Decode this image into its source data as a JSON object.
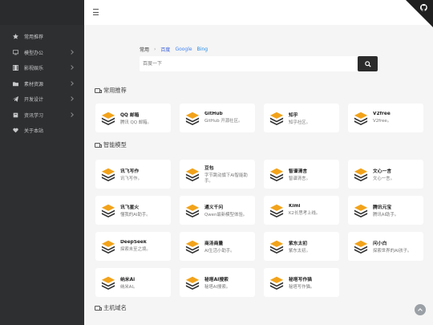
{
  "sidebar": {
    "items": [
      {
        "label": "常用推荐",
        "icon": "star-icon",
        "arrow": false
      },
      {
        "label": "模型办公",
        "icon": "monitor-icon",
        "arrow": true
      },
      {
        "label": "影视娱乐",
        "icon": "film-icon",
        "arrow": true
      },
      {
        "label": "素材资源",
        "icon": "folder-icon",
        "arrow": true
      },
      {
        "label": "开发设计",
        "icon": "paper-plane-icon",
        "arrow": true
      },
      {
        "label": "资讯学习",
        "icon": "book-icon",
        "arrow": true
      },
      {
        "label": "关于本站",
        "icon": "heart-icon",
        "arrow": false
      }
    ]
  },
  "search": {
    "tabs": [
      {
        "label": "常用",
        "cls": "active"
      },
      {
        "label": "›",
        "cls": "sep"
      },
      {
        "label": "百度",
        "cls": "baidu"
      },
      {
        "label": "Google",
        "cls": "google"
      },
      {
        "label": "Bing",
        "cls": "bing"
      }
    ],
    "placeholder": "百度一下"
  },
  "sections": [
    {
      "title": "常用推荐",
      "cards": [
        {
          "name": "QQ 邮箱",
          "desc": "腾讯 QQ 邮箱。"
        },
        {
          "name": "GitHub",
          "desc": "GitHub 开源社区。"
        },
        {
          "name": "知乎",
          "desc": "知乎社区。"
        },
        {
          "name": "V2free",
          "desc": "V2free。"
        }
      ]
    },
    {
      "title": "智能模型",
      "cards": [
        {
          "name": "讯飞写作",
          "desc": "讯飞写作。"
        },
        {
          "name": "豆包",
          "desc": "字节跳动旗下AI智能助手。"
        },
        {
          "name": "智谱清言",
          "desc": "智谱清言。"
        },
        {
          "name": "文心一言",
          "desc": "文心一言。"
        },
        {
          "name": "讯飞星火",
          "desc": "懂我的AI助手。"
        },
        {
          "name": "通义千问",
          "desc": "Qwen最新模型体验。"
        },
        {
          "name": "Kimi",
          "desc": "K2长思考上线。"
        },
        {
          "name": "腾讯元宝",
          "desc": "腾讯AI助手。"
        },
        {
          "name": "DeepSeek",
          "desc": "探索未至之境。"
        },
        {
          "name": "商汤商量",
          "desc": "AI生活小助手。"
        },
        {
          "name": "紫东太初",
          "desc": "紫东太初。"
        },
        {
          "name": "问小白",
          "desc": "探索世界的AI孩子。"
        },
        {
          "name": "纳米Ai",
          "desc": "纳米AI。"
        },
        {
          "name": "秘塔AI搜索",
          "desc": "秘塔AI搜索。"
        },
        {
          "name": "秘塔写作猫",
          "desc": "秘塔写作猫。"
        }
      ]
    },
    {
      "title": "主机域名",
      "cards": []
    }
  ],
  "colors": {
    "sidebar": "#2d2f30",
    "icon_orange": "#f2a31b",
    "icon_dark": "#333333"
  }
}
